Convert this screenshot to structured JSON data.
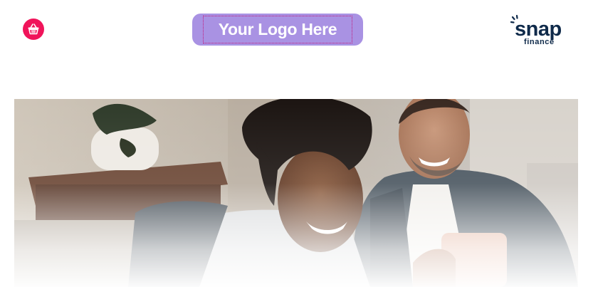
{
  "header": {
    "cart": {
      "icon": "basket-icon",
      "color": "#f0145a"
    },
    "logo_placeholder": {
      "text": "Your Logo Here",
      "bg_color": "#a992e3"
    },
    "partner_logo": {
      "word": "snap",
      "subword": "finance",
      "color": "#0f2a4a"
    }
  },
  "hero": {
    "image": "couple-smiling-at-phone-photo"
  }
}
